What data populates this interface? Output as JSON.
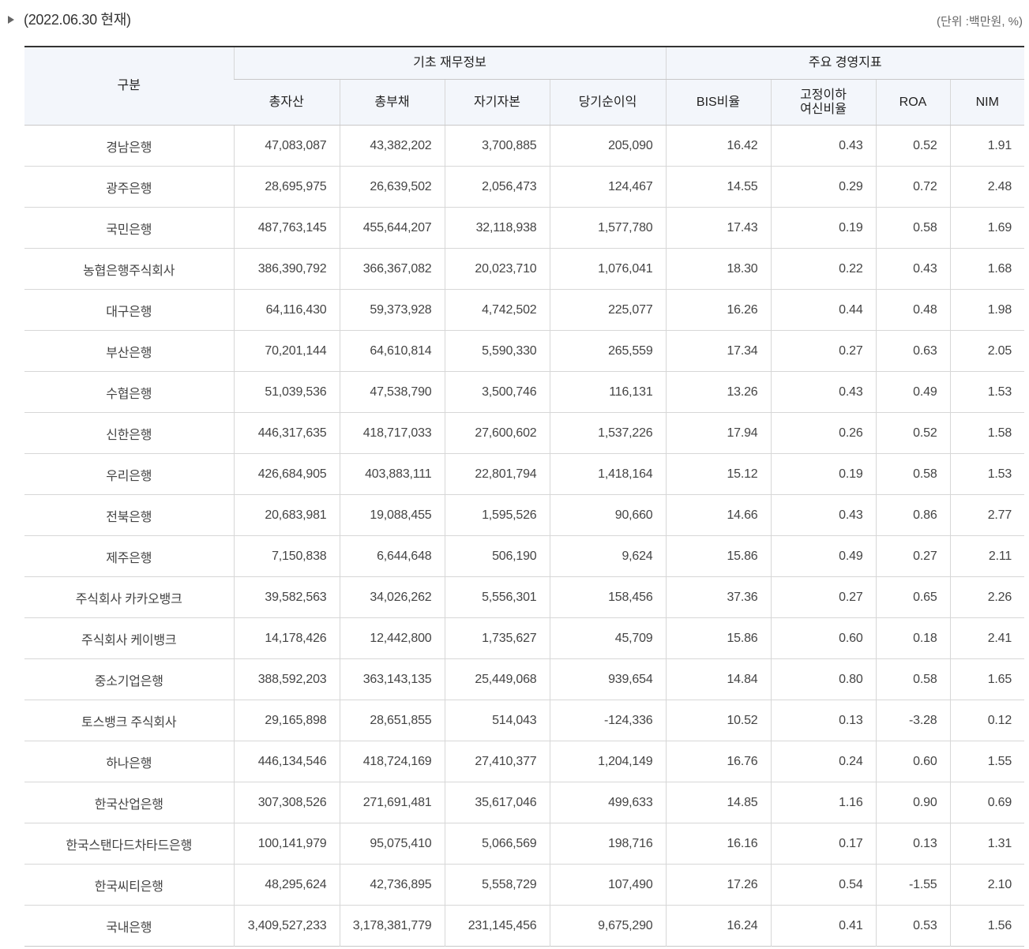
{
  "header": {
    "date": "(2022.06.30 현재)",
    "unit": "(단위 :백만원, %)"
  },
  "table": {
    "col_category": "구분",
    "group1": "기초 재무정보",
    "group2": "주요 경영지표",
    "columns": [
      "총자산",
      "총부채",
      "자기자본",
      "당기순이익",
      "BIS비율",
      "고정이하 여신비율",
      "ROA",
      "NIM"
    ],
    "rows": [
      [
        "경남은행",
        "47,083,087",
        "43,382,202",
        "3,700,885",
        "205,090",
        "16.42",
        "0.43",
        "0.52",
        "1.91"
      ],
      [
        "광주은행",
        "28,695,975",
        "26,639,502",
        "2,056,473",
        "124,467",
        "14.55",
        "0.29",
        "0.72",
        "2.48"
      ],
      [
        "국민은행",
        "487,763,145",
        "455,644,207",
        "32,118,938",
        "1,577,780",
        "17.43",
        "0.19",
        "0.58",
        "1.69"
      ],
      [
        "농협은행주식회사",
        "386,390,792",
        "366,367,082",
        "20,023,710",
        "1,076,041",
        "18.30",
        "0.22",
        "0.43",
        "1.68"
      ],
      [
        "대구은행",
        "64,116,430",
        "59,373,928",
        "4,742,502",
        "225,077",
        "16.26",
        "0.44",
        "0.48",
        "1.98"
      ],
      [
        "부산은행",
        "70,201,144",
        "64,610,814",
        "5,590,330",
        "265,559",
        "17.34",
        "0.27",
        "0.63",
        "2.05"
      ],
      [
        "수협은행",
        "51,039,536",
        "47,538,790",
        "3,500,746",
        "116,131",
        "13.26",
        "0.43",
        "0.49",
        "1.53"
      ],
      [
        "신한은행",
        "446,317,635",
        "418,717,033",
        "27,600,602",
        "1,537,226",
        "17.94",
        "0.26",
        "0.52",
        "1.58"
      ],
      [
        "우리은행",
        "426,684,905",
        "403,883,111",
        "22,801,794",
        "1,418,164",
        "15.12",
        "0.19",
        "0.58",
        "1.53"
      ],
      [
        "전북은행",
        "20,683,981",
        "19,088,455",
        "1,595,526",
        "90,660",
        "14.66",
        "0.43",
        "0.86",
        "2.77"
      ],
      [
        "제주은행",
        "7,150,838",
        "6,644,648",
        "506,190",
        "9,624",
        "15.86",
        "0.49",
        "0.27",
        "2.11"
      ],
      [
        "주식회사 카카오뱅크",
        "39,582,563",
        "34,026,262",
        "5,556,301",
        "158,456",
        "37.36",
        "0.27",
        "0.65",
        "2.26"
      ],
      [
        "주식회사 케이뱅크",
        "14,178,426",
        "12,442,800",
        "1,735,627",
        "45,709",
        "15.86",
        "0.60",
        "0.18",
        "2.41"
      ],
      [
        "중소기업은행",
        "388,592,203",
        "363,143,135",
        "25,449,068",
        "939,654",
        "14.84",
        "0.80",
        "0.58",
        "1.65"
      ],
      [
        "토스뱅크 주식회사",
        "29,165,898",
        "28,651,855",
        "514,043",
        "-124,336",
        "10.52",
        "0.13",
        "-3.28",
        "0.12"
      ],
      [
        "하나은행",
        "446,134,546",
        "418,724,169",
        "27,410,377",
        "1,204,149",
        "16.76",
        "0.24",
        "0.60",
        "1.55"
      ],
      [
        "한국산업은행",
        "307,308,526",
        "271,691,481",
        "35,617,046",
        "499,633",
        "14.85",
        "1.16",
        "0.90",
        "0.69"
      ],
      [
        "한국스탠다드차타드은행",
        "100,141,979",
        "95,075,410",
        "5,066,569",
        "198,716",
        "16.16",
        "0.17",
        "0.13",
        "1.31"
      ],
      [
        "한국씨티은행",
        "48,295,624",
        "42,736,895",
        "5,558,729",
        "107,490",
        "17.26",
        "0.54",
        "-1.55",
        "2.10"
      ],
      [
        "국내은행",
        "3,409,527,233",
        "3,178,381,779",
        "231,145,456",
        "9,675,290",
        "16.24",
        "0.41",
        "0.53",
        "1.56"
      ]
    ]
  }
}
